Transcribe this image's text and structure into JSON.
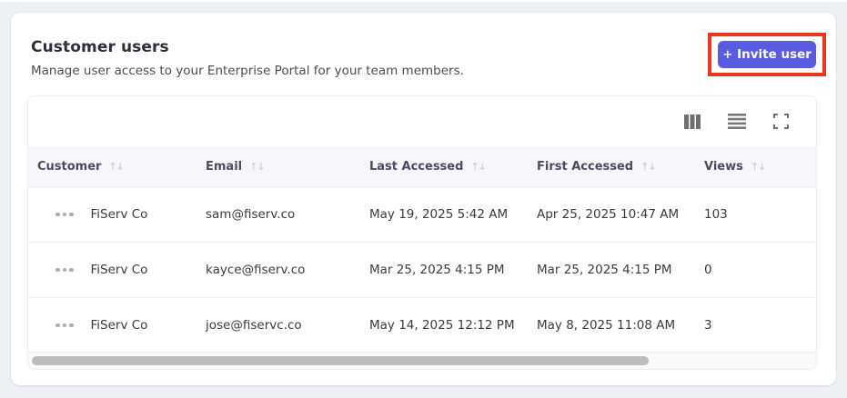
{
  "header": {
    "title": "Customer users",
    "subtitle": "Manage user access to your Enterprise Portal for your team members.",
    "invite_button_label": "+ Invite user"
  },
  "toolbar": {
    "icons": [
      "columns-icon",
      "density-icon",
      "fullscreen-icon"
    ]
  },
  "table": {
    "columns": [
      {
        "label": "Customer",
        "sortable": true
      },
      {
        "label": "Email",
        "sortable": true
      },
      {
        "label": "Last Accessed",
        "sortable": true
      },
      {
        "label": "First Accessed",
        "sortable": true
      },
      {
        "label": "Views",
        "sortable": true
      }
    ],
    "rows": [
      {
        "customer": "FiServ Co",
        "email": "sam@fiserv.co",
        "last_accessed": "May 19, 2025 5:42 AM",
        "first_accessed": "Apr 25, 2025 10:47 AM",
        "views": "103"
      },
      {
        "customer": "FiServ Co",
        "email": "kayce@fiserv.co",
        "last_accessed": "Mar 25, 2025 4:15 PM",
        "first_accessed": "Mar 25, 2025 4:15 PM",
        "views": "0"
      },
      {
        "customer": "FiServ Co",
        "email": "jose@fiservc.co",
        "last_accessed": "May 14, 2025 12:12 PM",
        "first_accessed": "May 8, 2025 11:08 AM",
        "views": "3"
      }
    ],
    "scrollbar": {
      "thumb_fraction": 0.78
    }
  },
  "icons": {
    "sort": "↑↓"
  },
  "colors": {
    "accent": "#5a5ce0",
    "annotation_red": "#e8351c",
    "page_bg": "#eef1f4",
    "header_row_bg": "#f7f7fb"
  }
}
